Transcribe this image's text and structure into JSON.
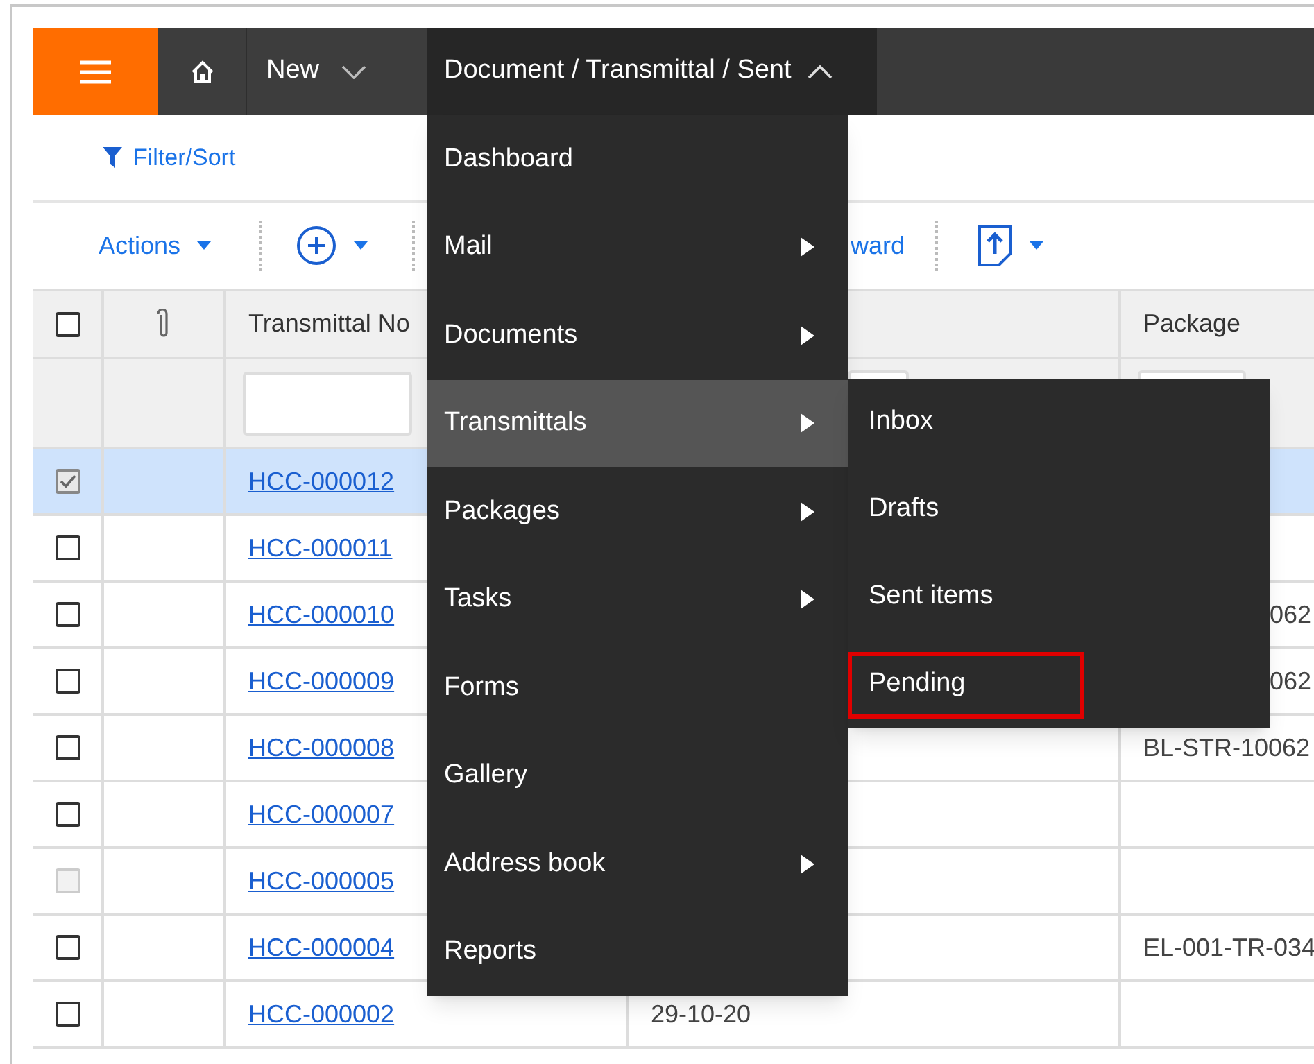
{
  "topbar": {
    "new_label": "New",
    "breadcrumb": {
      "label": "Document / Transmittal / Sent",
      "expanded": true
    }
  },
  "filter_bar": {
    "label": "Filter/Sort"
  },
  "toolbar": {
    "actions_label": "Actions",
    "forward_label": "ward"
  },
  "table": {
    "columns": [
      "Transmittal No",
      "",
      "Package"
    ],
    "header_checked": false,
    "rows": [
      {
        "checked": true,
        "disabled": false,
        "selected": true,
        "number": "HCC-000012"
      },
      {
        "checked": false,
        "disabled": false,
        "selected": false,
        "number": "HCC-000011"
      },
      {
        "checked": false,
        "disabled": false,
        "selected": false,
        "number": "HCC-000010",
        "package": "062",
        "package_covered": true
      },
      {
        "checked": false,
        "disabled": false,
        "selected": false,
        "number": "HCC-000009",
        "package": "062",
        "package_covered": true
      },
      {
        "checked": false,
        "disabled": false,
        "selected": false,
        "number": "HCC-000008",
        "package": "BL-STR-10062",
        "package_covered": false
      },
      {
        "checked": false,
        "disabled": false,
        "selected": false,
        "number": "HCC-000007"
      },
      {
        "checked": false,
        "disabled": true,
        "selected": false,
        "number": "HCC-000005"
      },
      {
        "checked": false,
        "disabled": false,
        "selected": false,
        "number": "HCC-000004",
        "package": "EL-001-TR-034",
        "package_covered": false
      },
      {
        "checked": false,
        "disabled": false,
        "selected": false,
        "number": "HCC-000002",
        "date": "29-10-20"
      }
    ]
  },
  "menu": {
    "items": [
      {
        "label": "Dashboard",
        "submenu": false,
        "selected": false
      },
      {
        "label": "Mail",
        "submenu": true,
        "selected": false
      },
      {
        "label": "Documents",
        "submenu": true,
        "selected": false
      },
      {
        "label": "Transmittals",
        "submenu": true,
        "selected": true
      },
      {
        "label": "Packages",
        "submenu": true,
        "selected": false
      },
      {
        "label": "Tasks",
        "submenu": true,
        "selected": false
      },
      {
        "label": "Forms",
        "submenu": false,
        "selected": false
      },
      {
        "label": "Gallery",
        "submenu": false,
        "selected": false
      },
      {
        "label": "Address book",
        "submenu": true,
        "selected": false
      },
      {
        "label": "Reports",
        "submenu": false,
        "selected": false
      }
    ]
  },
  "submenu": {
    "items": [
      {
        "label": "Inbox",
        "highlighted": false
      },
      {
        "label": "Drafts",
        "highlighted": false
      },
      {
        "label": "Sent items",
        "highlighted": false
      },
      {
        "label": "Pending",
        "highlighted": true
      }
    ]
  }
}
